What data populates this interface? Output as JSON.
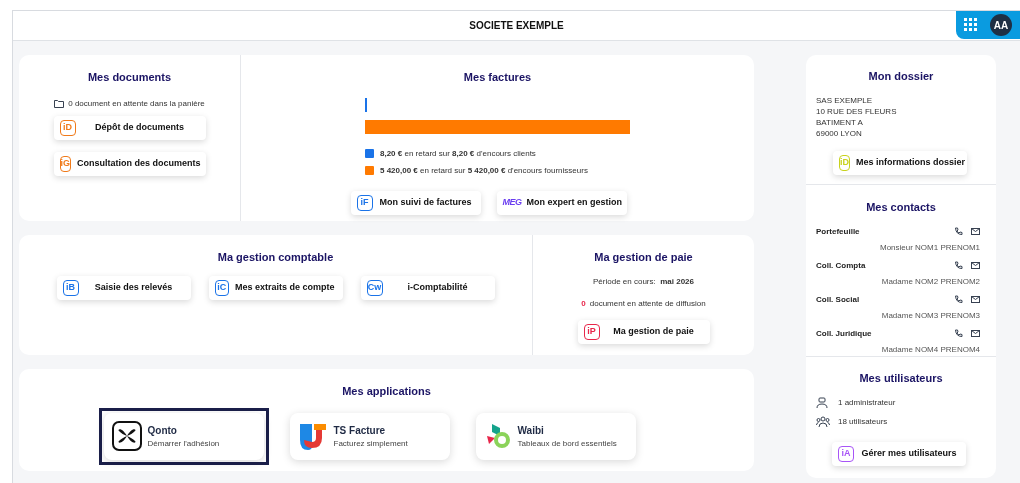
{
  "header": {
    "title": "SOCIETE EXEMPLE",
    "avatar": "AA"
  },
  "documents": {
    "title": "Mes documents",
    "status": "0 document en attente dans la panière",
    "buttons": [
      {
        "badge": "iD",
        "label": "Dépôt de documents",
        "color": "#f07a1a"
      },
      {
        "badge": "iG",
        "label": "Consultation des documents",
        "color": "#f07a1a"
      }
    ]
  },
  "factures": {
    "title": "Mes factures",
    "legend": [
      {
        "color": "#1a73e8",
        "text": "**8,20 €** en retard sur **8,20 €** d'encours clients"
      },
      {
        "color": "#ff7a00",
        "text": "**5 420,00 €** en retard sur **5 420,00 €** d'encours fournisseurs"
      }
    ],
    "buttons": [
      {
        "kind": "badge",
        "badge": "iF",
        "label": "Mon suivi de factures",
        "color": "#1a73e8"
      },
      {
        "kind": "logo",
        "badge": "MEG",
        "label": "Mon expert en gestion",
        "color": "#6a3df0"
      }
    ]
  },
  "comptable": {
    "title": "Ma gestion comptable",
    "buttons": [
      {
        "badge": "iB",
        "label": "Saisie des relevés",
        "color": "#1a73e8"
      },
      {
        "badge": "iC",
        "label": "Mes extraits de compte",
        "color": "#1a73e8"
      },
      {
        "badge": "Cw",
        "label": "i-Comptabilité",
        "color": "#1a73e8"
      }
    ]
  },
  "paie": {
    "title": "Ma gestion de paie",
    "period": "Période en cours:  **mai 2026**",
    "pending_count": "0",
    "pending_text": "document en attente de diffusion",
    "button": {
      "badge": "iP",
      "label": "Ma gestion de paie",
      "color": "#e8264a"
    }
  },
  "applications": {
    "title": "Mes applications",
    "items": [
      {
        "kind": "qonto",
        "name": "Qonto",
        "subtitle": "Démarrer l'adhésion",
        "selected": true
      },
      {
        "kind": "ts",
        "name": "TS Facture",
        "subtitle": "Facturez simplement",
        "selected": false
      },
      {
        "kind": "waibi",
        "name": "Waibi",
        "subtitle": "Tableaux de bord essentiels",
        "selected": false
      }
    ]
  },
  "dossier": {
    "title": "Mon dossier",
    "address": [
      "SAS EXEMPLE",
      "10 RUE DES FLEURS",
      "BATIMENT A",
      "69000 LYON"
    ],
    "button": {
      "badge": "iD",
      "label": "Mes informations dossier",
      "color": "#c8d21e"
    }
  },
  "contacts": {
    "title": "Mes contacts",
    "items": [
      {
        "role": "Portefeuille",
        "name": "Monsieur NOM1 PRENOM1"
      },
      {
        "role": "Coll. Compta",
        "name": "Madame NOM2 PRENOM2"
      },
      {
        "role": "Coll. Social",
        "name": "Madame NOM3 PRENOM3"
      },
      {
        "role": "Coll. Juridique",
        "name": "Madame NOM4 PRENOM4"
      }
    ]
  },
  "users": {
    "title": "Mes utilisateurs",
    "rows": [
      {
        "kind": "admin",
        "text": "1 administrateur"
      },
      {
        "kind": "users",
        "text": "18 utilisateurs"
      }
    ],
    "button": {
      "badge": "iA",
      "label": "Gérer mes utilisateurs",
      "color": "#a855f7"
    }
  }
}
